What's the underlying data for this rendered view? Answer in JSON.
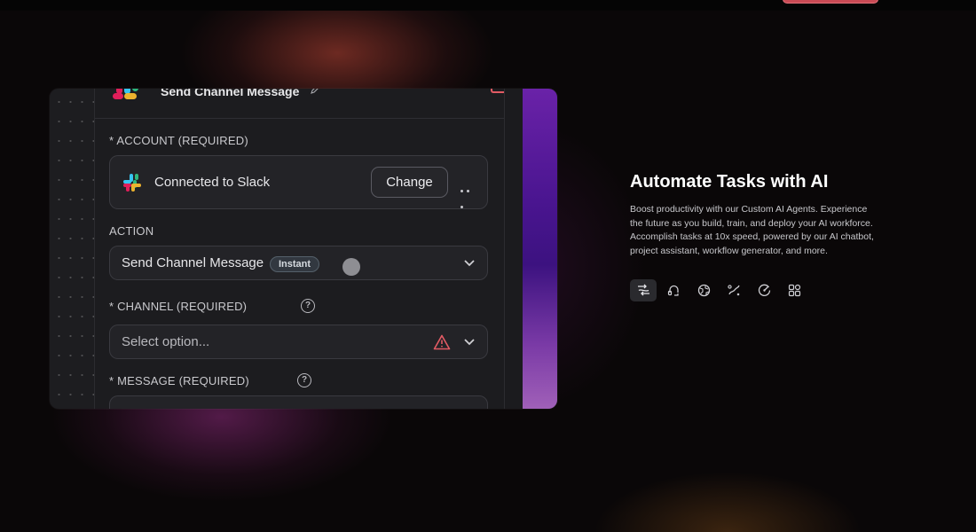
{
  "panel": {
    "title": "Send Channel Message",
    "account": {
      "label": "* ACCOUNT (REQUIRED)",
      "connection_text": "Connected to Slack",
      "change_label": "Change"
    },
    "action": {
      "label": "ACTION",
      "value": "Send Channel Message",
      "badge": "Instant"
    },
    "channel": {
      "label": "* CHANNEL (REQUIRED)",
      "placeholder": "Select option...",
      "help": "?"
    },
    "message": {
      "label": "* MESSAGE (REQUIRED)",
      "help": "?"
    }
  },
  "feature": {
    "title": "Automate Tasks with AI",
    "description_lines": [
      "Boost productivity with our Custom AI Agents. Experience",
      "the future as you build, train, and deploy your AI workforce.",
      "Accomplish tasks at 10x speed, powered by our AI chatbot,",
      "project assistant, workflow generator, and more."
    ],
    "tabs": [
      {
        "icon": "workflow-icon",
        "active": true
      },
      {
        "icon": "headset-icon",
        "active": false
      },
      {
        "icon": "globe-icon",
        "active": false
      },
      {
        "icon": "route-icon",
        "active": false
      },
      {
        "icon": "speed-icon",
        "active": false
      },
      {
        "icon": "apps-grid-icon",
        "active": false
      }
    ]
  },
  "colors": {
    "accent_red": "#e25b64",
    "purple": "#5b1fa0",
    "background": "#0a0708"
  }
}
